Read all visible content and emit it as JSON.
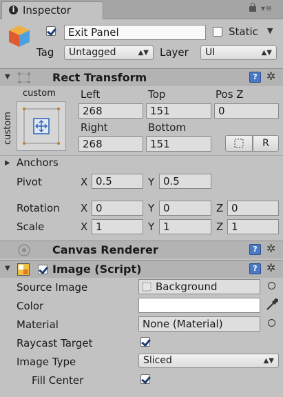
{
  "tab": {
    "title": "Inspector"
  },
  "object": {
    "active": true,
    "name": "Exit Panel",
    "static_label": "Static",
    "static": false
  },
  "tag": {
    "label": "Tag",
    "value": "Untagged"
  },
  "layer": {
    "label": "Layer",
    "value": "UI"
  },
  "rect_transform": {
    "title": "Rect Transform",
    "anchor_top_label": "custom",
    "anchor_side_label": "custom",
    "left_label": "Left",
    "left": "268",
    "top_label": "Top",
    "top": "151",
    "posz_label": "Pos Z",
    "posz": "0",
    "right_label": "Right",
    "right": "268",
    "bottom_label": "Bottom",
    "bottom": "151",
    "raw_button": "R",
    "anchors_label": "Anchors",
    "pivot_label": "Pivot",
    "pivot_x": "0.5",
    "pivot_y": "0.5",
    "rotation_label": "Rotation",
    "rot_x": "0",
    "rot_y": "0",
    "rot_z": "0",
    "scale_label": "Scale",
    "scale_x": "1",
    "scale_y": "1",
    "scale_z": "1",
    "axis_x": "X",
    "axis_y": "Y",
    "axis_z": "Z"
  },
  "canvas_renderer": {
    "title": "Canvas Renderer"
  },
  "image_script": {
    "title": "Image (Script)",
    "enabled": true,
    "source_image_label": "Source Image",
    "source_image": "Background",
    "color_label": "Color",
    "color": "#ffffff",
    "material_label": "Material",
    "material": "None (Material)",
    "raycast_label": "Raycast Target",
    "raycast": true,
    "image_type_label": "Image Type",
    "image_type": "Sliced",
    "fill_center_label": "Fill Center",
    "fill_center": true
  },
  "colors": {
    "panel_bg": "#c2c2c2",
    "section_bg": "#b3b3b3",
    "accent_blue": "#4b79c4"
  }
}
